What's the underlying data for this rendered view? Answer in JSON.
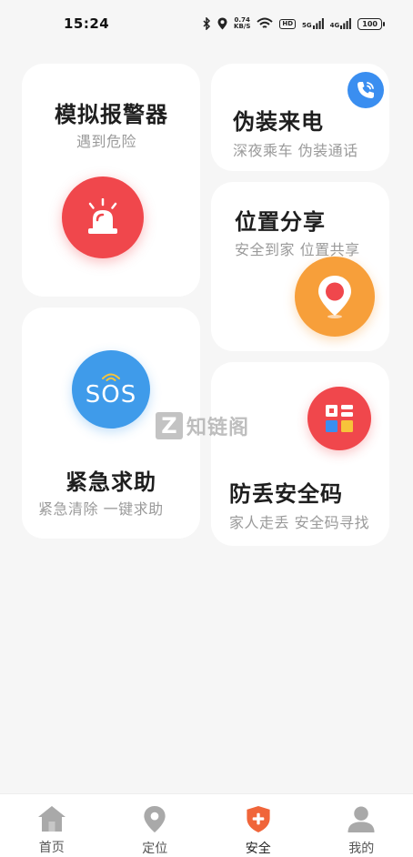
{
  "status_bar": {
    "time": "15:24",
    "speed_value": "0.74",
    "speed_unit": "KB/S",
    "hd_label": "HD",
    "net1_label": "5G",
    "net2_label": "4G",
    "battery": "100"
  },
  "cards": {
    "alarm": {
      "title": "模拟报警器",
      "subtitle": "遇到危险",
      "icon": "siren-icon",
      "color": "#f0474c"
    },
    "fake_call": {
      "title": "伪装来电",
      "subtitle": "深夜乘车  伪装通话",
      "icon": "phone-icon",
      "color": "#3a8ef0"
    },
    "location_share": {
      "title": "位置分享",
      "subtitle": "安全到家  位置共享",
      "icon": "location-pin-icon",
      "color": "#f79f3a"
    },
    "sos": {
      "title": "紧急求助",
      "subtitle": "紧急清除  一键求助",
      "icon_text": "SOS",
      "icon": "sos-icon",
      "color": "#3f9bea"
    },
    "anti_lost": {
      "title": "防丢安全码",
      "subtitle": "家人走丢  安全码寻找",
      "icon": "qr-code-icon",
      "color": "#f0474c"
    }
  },
  "watermark": {
    "letter": "Z",
    "text": "知链阁"
  },
  "bottom_nav": {
    "items": [
      {
        "label": "首页",
        "icon": "home-icon",
        "active": false
      },
      {
        "label": "定位",
        "icon": "location-icon",
        "active": false
      },
      {
        "label": "安全",
        "icon": "shield-plus-icon",
        "active": true
      },
      {
        "label": "我的",
        "icon": "user-icon",
        "active": false
      }
    ],
    "active_color": "#f0653a",
    "inactive_color": "#a9a9a9"
  }
}
